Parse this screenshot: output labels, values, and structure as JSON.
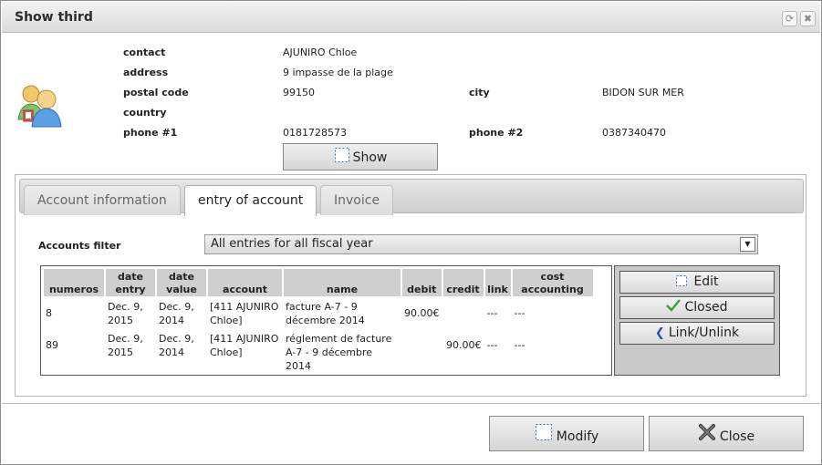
{
  "window": {
    "title": "Show third",
    "controls": [
      {
        "name": "refresh-icon",
        "glyph": "⟳"
      },
      {
        "name": "close-icon",
        "glyph": "✖"
      }
    ]
  },
  "contact": {
    "contact_label": "contact",
    "contact_value": "AJUNIRO Chloe",
    "address_label": "address",
    "address_value": "9 impasse de la plage",
    "postal_label": "postal code",
    "postal_value": "99150",
    "city_label": "city",
    "city_value": "BIDON SUR MER",
    "country_label": "country",
    "country_value": "",
    "phone1_label": "phone #1",
    "phone1_value": "0181728573",
    "phone2_label": "phone #2",
    "phone2_value": "0387340470",
    "show_button": "Show"
  },
  "tabs": [
    {
      "label": "Account information",
      "active": false
    },
    {
      "label": "entry of account",
      "active": true
    },
    {
      "label": "Invoice",
      "active": false
    }
  ],
  "filter": {
    "label": "Accounts filter",
    "selected": "All entries for all fiscal year"
  },
  "grid": {
    "columns": [
      "numeros",
      "date entry",
      "date value",
      "account",
      "name",
      "debit",
      "credit",
      "link",
      "cost accounting"
    ],
    "rows": [
      [
        "8",
        "Dec. 9, 2015",
        "Dec. 9, 2014",
        "[411 AJUNIRO Chloe]",
        "facture A-7 - 9 décembre 2014",
        "90.00€",
        "",
        "---",
        "---"
      ],
      [
        "89",
        "Dec. 9, 2015",
        "Dec. 9, 2014",
        "[411 AJUNIRO Chloe]",
        "réglement de facture A-7 - 9 décembre 2014",
        "",
        "90.00€",
        "---",
        "---"
      ]
    ]
  },
  "actions": {
    "edit": "Edit",
    "closed": "Closed",
    "link_unlink": "Link/Unlink"
  },
  "footer": {
    "modify": "Modify",
    "close": "Close"
  },
  "colors": {
    "check_green": "#3aa53a",
    "link_blue": "#2a4fb0",
    "title_gradient_top": "#f3f3f3"
  }
}
